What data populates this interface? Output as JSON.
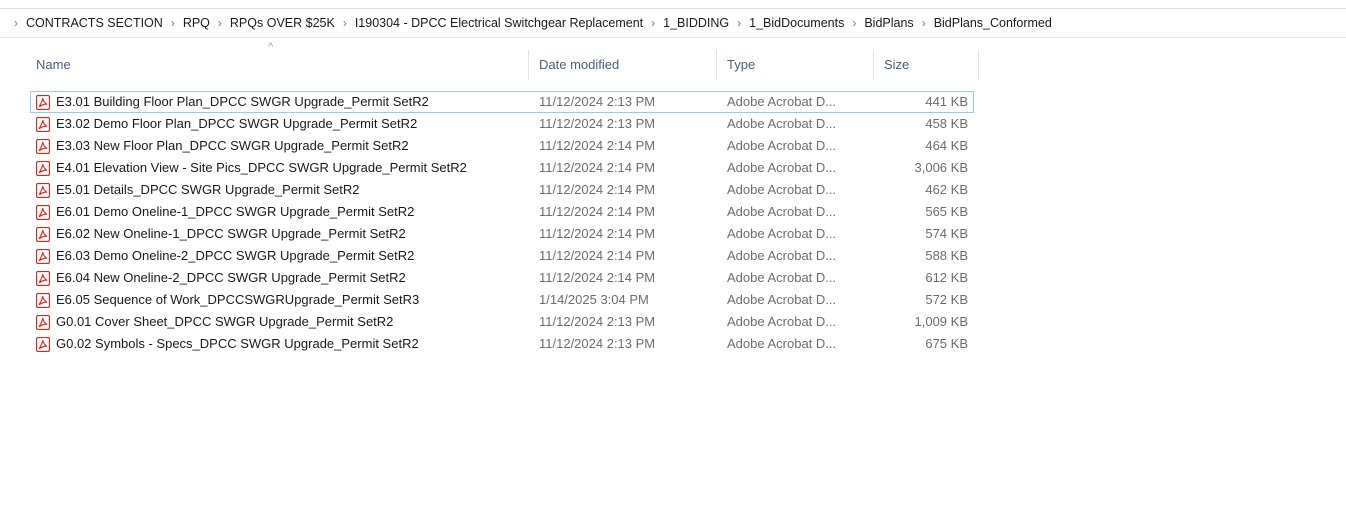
{
  "breadcrumb": [
    "CONTRACTS SECTION",
    "RPQ",
    "RPQs OVER $25K",
    "I190304 - DPCC Electrical Switchgear Replacement",
    "1_BIDDING",
    "1_BidDocuments",
    "BidPlans",
    "BidPlans_Conformed"
  ],
  "columns": {
    "name": "Name",
    "date": "Date modified",
    "type": "Type",
    "size": "Size"
  },
  "files": [
    {
      "name": "E3.01 Building Floor Plan_DPCC SWGR Upgrade_Permit SetR2",
      "date": "11/12/2024 2:13 PM",
      "type": "Adobe Acrobat D...",
      "size": "441 KB"
    },
    {
      "name": "E3.02 Demo Floor Plan_DPCC SWGR Upgrade_Permit SetR2",
      "date": "11/12/2024 2:13 PM",
      "type": "Adobe Acrobat D...",
      "size": "458 KB"
    },
    {
      "name": "E3.03 New Floor Plan_DPCC SWGR Upgrade_Permit SetR2",
      "date": "11/12/2024 2:14 PM",
      "type": "Adobe Acrobat D...",
      "size": "464 KB"
    },
    {
      "name": "E4.01 Elevation View - Site Pics_DPCC SWGR Upgrade_Permit SetR2",
      "date": "11/12/2024 2:14 PM",
      "type": "Adobe Acrobat D...",
      "size": "3,006 KB"
    },
    {
      "name": "E5.01 Details_DPCC SWGR Upgrade_Permit SetR2",
      "date": "11/12/2024 2:14 PM",
      "type": "Adobe Acrobat D...",
      "size": "462 KB"
    },
    {
      "name": "E6.01 Demo Oneline-1_DPCC SWGR Upgrade_Permit SetR2",
      "date": "11/12/2024 2:14 PM",
      "type": "Adobe Acrobat D...",
      "size": "565 KB"
    },
    {
      "name": "E6.02 New Oneline-1_DPCC SWGR Upgrade_Permit SetR2",
      "date": "11/12/2024 2:14 PM",
      "type": "Adobe Acrobat D...",
      "size": "574 KB"
    },
    {
      "name": "E6.03 Demo Oneline-2_DPCC SWGR Upgrade_Permit SetR2",
      "date": "11/12/2024 2:14 PM",
      "type": "Adobe Acrobat D...",
      "size": "588 KB"
    },
    {
      "name": "E6.04 New Oneline-2_DPCC SWGR Upgrade_Permit SetR2",
      "date": "11/12/2024 2:14 PM",
      "type": "Adobe Acrobat D...",
      "size": "612 KB"
    },
    {
      "name": "E6.05 Sequence of Work_DPCCSWGRUpgrade_Permit SetR3",
      "date": "1/14/2025 3:04 PM",
      "type": "Adobe Acrobat D...",
      "size": "572 KB"
    },
    {
      "name": "G0.01 Cover Sheet_DPCC SWGR Upgrade_Permit SetR2",
      "date": "11/12/2024 2:13 PM",
      "type": "Adobe Acrobat D...",
      "size": "1,009 KB"
    },
    {
      "name": "G0.02 Symbols - Specs_DPCC SWGR Upgrade_Permit SetR2",
      "date": "11/12/2024 2:13 PM",
      "type": "Adobe Acrobat D...",
      "size": "675 KB"
    }
  ],
  "selected_index": 0,
  "icons": {
    "breadcrumb_separator": "chevron-right-icon",
    "file": "pdf-file-icon",
    "sort": "sort-ascending-icon"
  },
  "colors": {
    "pdf_red": "#d9261c",
    "selection_border": "#99c9ef",
    "header_text": "#4c607a"
  }
}
